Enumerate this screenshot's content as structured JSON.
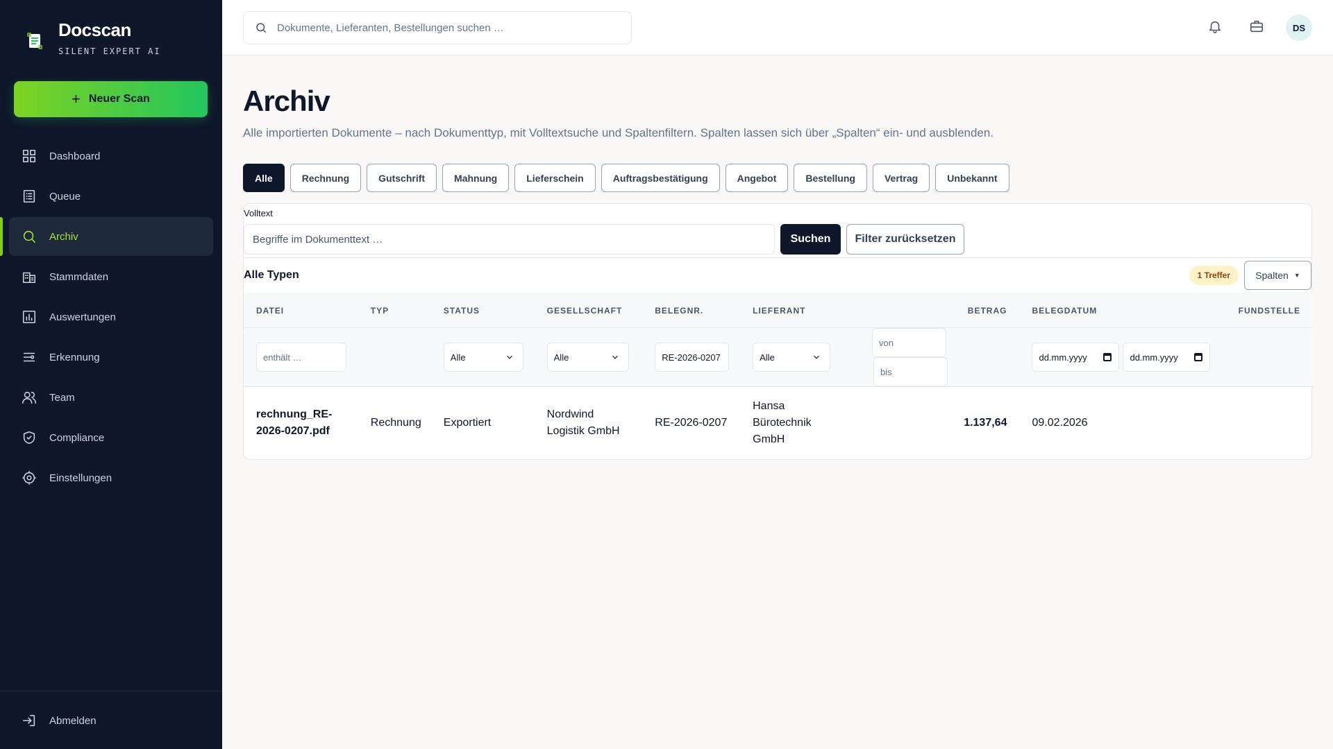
{
  "brand": {
    "name": "Docscan",
    "subtitle": "SILENT EXPERT AI"
  },
  "sidebar": {
    "new_scan_label": "Neuer Scan",
    "items": [
      {
        "label": "Dashboard",
        "icon": "grid-icon"
      },
      {
        "label": "Queue",
        "icon": "list-icon"
      },
      {
        "label": "Archiv",
        "icon": "search-icon",
        "active": true
      },
      {
        "label": "Stammdaten",
        "icon": "building-icon"
      },
      {
        "label": "Auswertungen",
        "icon": "chart-icon"
      },
      {
        "label": "Erkennung",
        "icon": "sliders-icon"
      },
      {
        "label": "Team",
        "icon": "users-icon"
      },
      {
        "label": "Compliance",
        "icon": "shield-icon"
      },
      {
        "label": "Einstellungen",
        "icon": "gear-icon"
      }
    ],
    "logout_label": "Abmelden"
  },
  "topbar": {
    "search_placeholder": "Dokumente, Lieferanten, Bestellungen suchen …",
    "avatar_initials": "DS"
  },
  "page": {
    "title": "Archiv",
    "description": "Alle importierten Dokumente – nach Dokumenttyp, mit Volltextsuche und Spaltenfiltern. Spalten lassen sich über „Spalten“ ein- und ausblenden."
  },
  "type_tabs": [
    "Alle",
    "Rechnung",
    "Gutschrift",
    "Mahnung",
    "Lieferschein",
    "Auftragsbestätigung",
    "Angebot",
    "Bestellung",
    "Vertrag",
    "Unbekannt"
  ],
  "fulltext": {
    "label": "Volltext",
    "placeholder": "Begriffe im Dokumenttext …",
    "search_label": "Suchen",
    "reset_label": "Filter zurücksetzen"
  },
  "list": {
    "title": "Alle Typen",
    "hits": "1 Treffer",
    "columns_label": "Spalten"
  },
  "table": {
    "headers": {
      "datei": "DATEI",
      "typ": "TYP",
      "status": "STATUS",
      "gesellschaft": "GESELLSCHAFT",
      "belegnr": "BELEGNR.",
      "lieferant": "LIEFERANT",
      "betrag": "BETRAG",
      "belegdatum": "BELEGDATUM",
      "fundstelle": "FUNDSTELLE"
    },
    "filters": {
      "datei_placeholder": "enthält …",
      "status": "Alle",
      "gesellschaft": "Alle",
      "belegnr": "RE-2026-0207",
      "lieferant": "Alle",
      "betrag_from_placeholder": "von",
      "betrag_to_placeholder": "bis",
      "date_from": "dd.mm.yyyy",
      "date_to": "dd.mm.yyyy"
    },
    "rows": [
      {
        "datei_1": "rechnung_RE-",
        "datei_2": "2026-0207.pdf",
        "typ": "Rechnung",
        "status": "Exportiert",
        "gesellschaft_1": "Nordwind",
        "gesellschaft_2": "Logistik GmbH",
        "belegnr": "RE-2026-0207",
        "lieferant_1": "Hansa",
        "lieferant_2": "Bürotechnik",
        "lieferant_3": "GmbH",
        "betrag": "1.137,64",
        "belegdatum": "09.02.2026",
        "fundstelle": ""
      }
    ]
  },
  "colors": {
    "sidebar_bg": "#0f172a",
    "accent": "#84cc16",
    "primary_dark": "#0f172a",
    "badge_bg": "#fef3c7"
  }
}
